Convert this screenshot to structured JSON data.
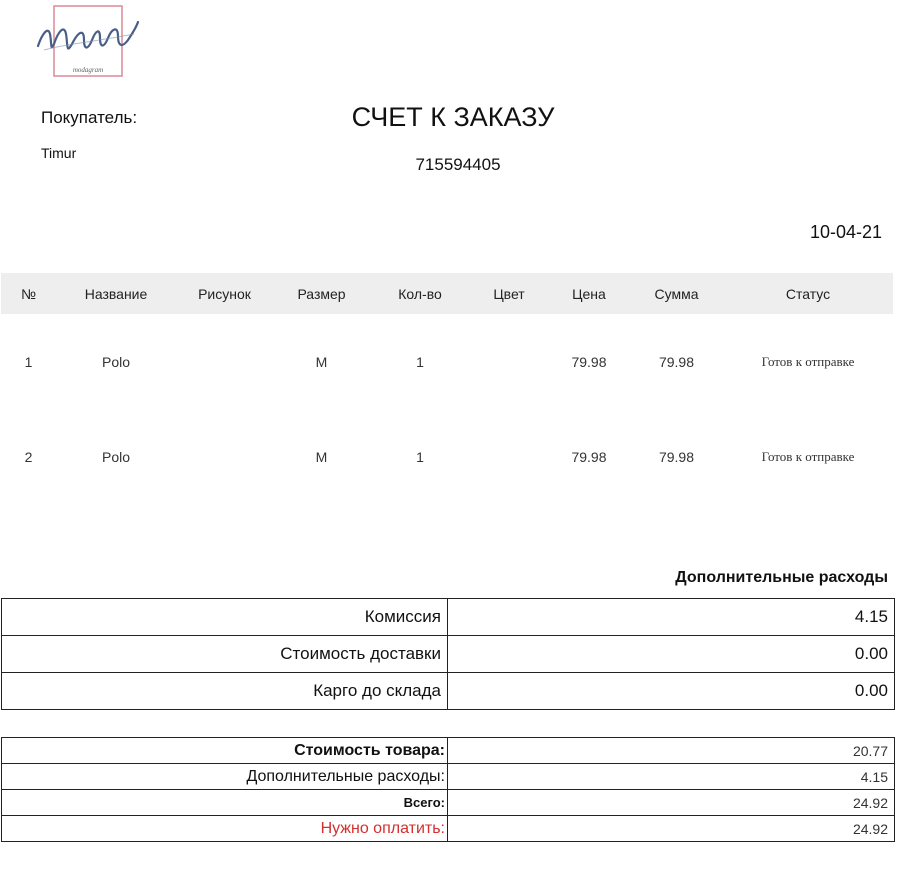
{
  "header": {
    "buyer_label": "Покупатель:",
    "buyer_name": "Timur",
    "title": "СЧЕТ К ЗАКАЗУ",
    "order_number": "715594405",
    "date": "10-04-21"
  },
  "items_table": {
    "columns": [
      "№",
      "Название",
      "Рисунок",
      "Размер",
      "Кол-во",
      "Цвет",
      "Цена",
      "Сумма",
      "Статус"
    ],
    "rows": [
      {
        "num": "1",
        "name": "Polo",
        "picture": "",
        "size": "M",
        "qty": "1",
        "color": "",
        "price": "79.98",
        "sum": "79.98",
        "status": "Готов к отправке"
      },
      {
        "num": "2",
        "name": "Polo",
        "picture": "",
        "size": "M",
        "qty": "1",
        "color": "",
        "price": "79.98",
        "sum": "79.98",
        "status": "Готов к отправке"
      }
    ]
  },
  "extra": {
    "title": "Дополнительные расходы",
    "rows": [
      {
        "label": "Комиссия",
        "value": "4.15"
      },
      {
        "label": "Стоимость доставки",
        "value": "0.00"
      },
      {
        "label": "Карго до склада",
        "value": "0.00"
      }
    ]
  },
  "totals": {
    "goods_label": "Стоимость товара:",
    "goods_value": "20.77",
    "extra_label": "Дополнительные расходы:",
    "extra_value": "4.15",
    "total_label": "Всего:",
    "total_value": "24.92",
    "due_label": "Нужно оплатить:",
    "due_value": "24.92"
  },
  "colors": {
    "header_bg": "#eeeeee",
    "due_label": "#d32f2f",
    "logo_frame": "#d98a95",
    "logo_ink": "#4a5f86"
  }
}
